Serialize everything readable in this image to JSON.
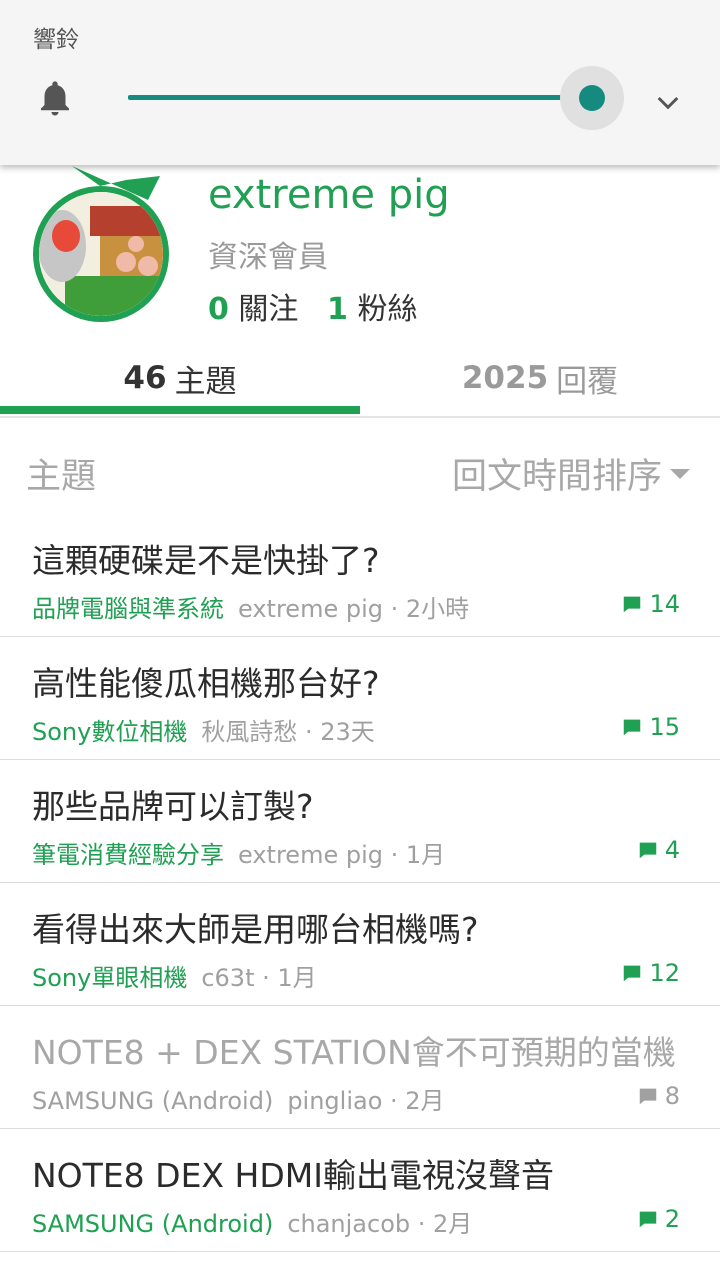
{
  "volume": {
    "title": "響鈴",
    "level": 0.98,
    "accent": "#158a7e"
  },
  "profile": {
    "name": "extreme pig",
    "rank": "資深會員",
    "following_count": "0",
    "following_label": "關注",
    "followers_count": "1",
    "followers_label": "粉絲",
    "accent": "#1fa052"
  },
  "tabs": [
    {
      "count": "46",
      "label": "主題",
      "active": true
    },
    {
      "count": "2025",
      "label": "回覆",
      "active": false
    }
  ],
  "list_header": {
    "label": "主題",
    "sort_label": "回文時間排序"
  },
  "topics": [
    {
      "title": "這顆硬碟是不是快掛了?",
      "forum": "品牌電腦與準系統",
      "author": "extreme pig · 2小時",
      "replies": "14",
      "locked": false
    },
    {
      "title": "高性能傻瓜相機那台好?",
      "forum": "Sony數位相機",
      "author": "秋風詩愁 · 23天",
      "replies": "15",
      "locked": false
    },
    {
      "title": "那些品牌可以訂製?",
      "forum": "筆電消費經驗分享",
      "author": "extreme pig · 1月",
      "replies": "4",
      "locked": false
    },
    {
      "title": "看得出來大師是用哪台相機嗎?",
      "forum": "Sony單眼相機",
      "author": "c63t · 1月",
      "replies": "12",
      "locked": false
    },
    {
      "title": "NOTE8 + DEX STATION會不可預期的當機",
      "forum": "SAMSUNG (Android)",
      "author": "pingliao · 2月",
      "replies": "8",
      "locked": true
    },
    {
      "title": "NOTE8 DEX HDMI輸出電視沒聲音",
      "forum": "SAMSUNG (Android)",
      "author": "chanjacob · 2月",
      "replies": "2",
      "locked": false
    }
  ]
}
